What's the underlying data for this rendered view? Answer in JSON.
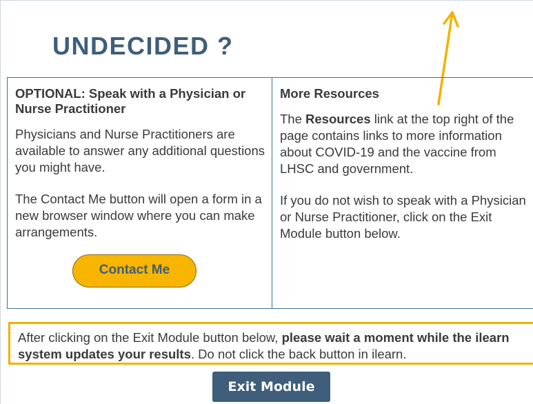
{
  "heading": "UNDECIDED ?",
  "colors": {
    "heading": "#3e5e7b",
    "panel_border": "#3e6e95",
    "contact_button": "#f7b500",
    "notice_border": "#f2b100",
    "exit_button": "#3e5e7b",
    "arrow": "#f2b100"
  },
  "annotation": {
    "icon": "arrow-up-icon"
  },
  "left_column": {
    "title": "OPTIONAL: Speak with a Physician or Nurse Practitioner",
    "paragraph1": "Physicians and Nurse Practitioners are available to answer any additional questions you might have.",
    "paragraph2": "The Contact Me button will open a form in a new browser window where you can make arrangements.",
    "contact_button_label": "Contact Me"
  },
  "right_column": {
    "title": "More Resources",
    "p1_prefix": "The ",
    "p1_bold": "Resources",
    "p1_suffix": " link at the top right of the page contains links to more information about COVID-19 and the vaccine from LHSC and government.",
    "paragraph2": "If you do not wish to speak with a Physician or Nurse Practitioner, click on the Exit Module button below."
  },
  "notice": {
    "prefix": "After clicking on the Exit Module button below, ",
    "bold": "please wait a moment while the ilearn system updates your results",
    "suffix": ". Do not click the back button in ilearn."
  },
  "exit_button_label": "Exit Module"
}
